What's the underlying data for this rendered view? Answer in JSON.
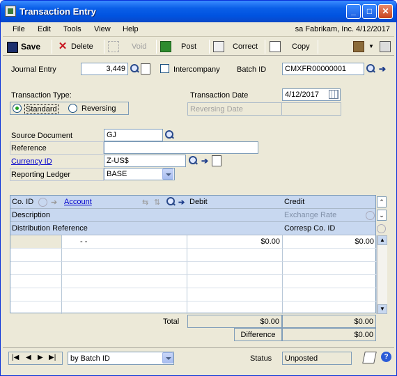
{
  "window": {
    "title": "Transaction Entry"
  },
  "menu": {
    "items": [
      "File",
      "Edit",
      "Tools",
      "View",
      "Help"
    ],
    "user_info": "sa  Fabrikam, Inc.  4/12/2017"
  },
  "toolbar": {
    "save": "Save",
    "delete": "Delete",
    "void": "Void",
    "post": "Post",
    "correct": "Correct",
    "copy": "Copy"
  },
  "header": {
    "journal_entry_label": "Journal Entry",
    "journal_entry_value": "3,449",
    "intercompany_label": "Intercompany",
    "batch_id_label": "Batch ID",
    "batch_id_value": "CMXFR00000001",
    "transaction_type_label": "Transaction Type:",
    "standard_label": "Standard",
    "reversing_label": "Reversing",
    "transaction_date_label": "Transaction Date",
    "transaction_date_value": "4/12/2017",
    "reversing_date_label": "Reversing Date",
    "source_document_label": "Source Document",
    "source_document_value": "GJ",
    "reference_label": "Reference",
    "reference_value": "",
    "currency_id_label": "Currency ID",
    "currency_id_value": "Z-US$",
    "reporting_ledger_label": "Reporting Ledger",
    "reporting_ledger_value": "BASE"
  },
  "grid": {
    "col_co_id": "Co. ID",
    "col_account": "Account",
    "col_debit": "Debit",
    "col_credit": "Credit",
    "col_description": "Description",
    "col_exchange_rate": "Exchange Rate",
    "col_distribution_reference": "Distribution Reference",
    "col_corresp_co_id": "Corresp Co. ID",
    "row1_account": "-       -",
    "row1_debit": "$0.00",
    "row1_credit": "$0.00"
  },
  "totals": {
    "total_label": "Total",
    "total_debit": "$0.00",
    "total_credit": "$0.00",
    "difference_label": "Difference",
    "difference_value": "$0.00"
  },
  "footer": {
    "sort_value": "by Batch ID",
    "status_label": "Status",
    "status_value": "Unposted"
  }
}
